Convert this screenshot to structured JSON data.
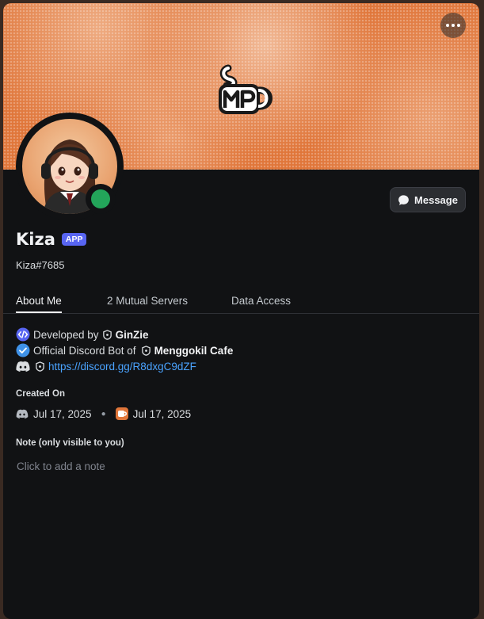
{
  "banner": {
    "logo_text": "SMP",
    "accent_color": "#e0763a"
  },
  "profile": {
    "display_name": "Kiza",
    "badge": "APP",
    "username": "Kiza#7685",
    "status": "online",
    "status_color": "#23a55a"
  },
  "actions": {
    "message_label": "Message",
    "more_icon": "more-icon"
  },
  "tabs": [
    {
      "label": "About Me",
      "active": true
    },
    {
      "label": "2 Mutual Servers",
      "active": false
    },
    {
      "label": "Data Access",
      "active": false
    }
  ],
  "about": {
    "line1_prefix": "Developed by",
    "line1_name": "GinZie",
    "line2_prefix": "Official Discord Bot of",
    "line2_name": "Menggokil Cafe",
    "line3_link": "https://discord.gg/R8dxgC9dZF"
  },
  "created_on": {
    "title": "Created On",
    "discord_date": "Jul 17, 2025",
    "server_date": "Jul 17, 2025"
  },
  "note": {
    "title": "Note (only visible to you)",
    "placeholder": "Click to add a note"
  }
}
